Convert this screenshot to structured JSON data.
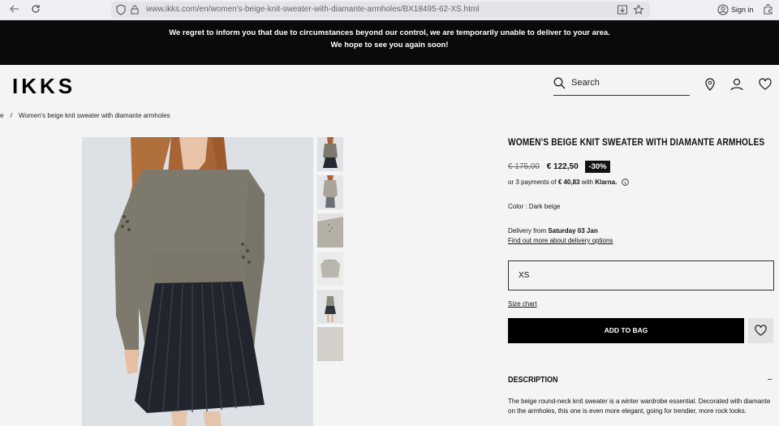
{
  "browser": {
    "url": "www.ikks.com/en/women's-beige-knit-sweater-with-diamante-armholes/BX18495-62-XS.html",
    "signin_label": "Sign in"
  },
  "banner": {
    "line1": "We regret to inform you that due to circumstances beyond our control, we are temporarily unable to deliver to your area.",
    "line2": "We hope to see you again soon!"
  },
  "header": {
    "logo": "IKKS",
    "search_label": "Search"
  },
  "breadcrumb": {
    "prev": "e",
    "separator": "/",
    "current": "Women's beige knit sweater with diamante armholes"
  },
  "product": {
    "title": "WOMEN'S BEIGE KNIT SWEATER WITH DIAMANTE ARMHOLES",
    "old_price": "€ 175,00",
    "new_price": "€ 122,50",
    "discount": "-30%",
    "klarna_prefix": "or 3 payments of ",
    "klarna_amount": "€ 40,83",
    "klarna_with": " with ",
    "klarna_brand": "Klarna.",
    "color_line": "Color : Dark beige",
    "delivery_prefix": "Delivery from ",
    "delivery_date": "Saturday 03 Jan",
    "delivery_link": "Find out more about delivery options",
    "size_value": "XS",
    "size_chart": "Size chart",
    "add_to_bag": "ADD TO BAG",
    "description_heading": "DESCRIPTION",
    "description_toggle": "–",
    "description_text": "The beige round-neck knit sweater is a winter wardrobe essential. Decorated with diamante on the armholes, this one is even more elegant, going for trendier, more rock looks."
  },
  "colors": {
    "banner_bg": "#0a0a0a",
    "button_bg": "#000000",
    "page_bg": "#f4f4f4"
  },
  "icons": [
    "back-arrow-icon",
    "reload-icon",
    "shield-icon",
    "lock-icon",
    "download-icon",
    "star-icon",
    "account-icon",
    "extensions-icon",
    "search-icon",
    "location-pin-icon",
    "user-icon",
    "heart-icon",
    "info-icon"
  ]
}
